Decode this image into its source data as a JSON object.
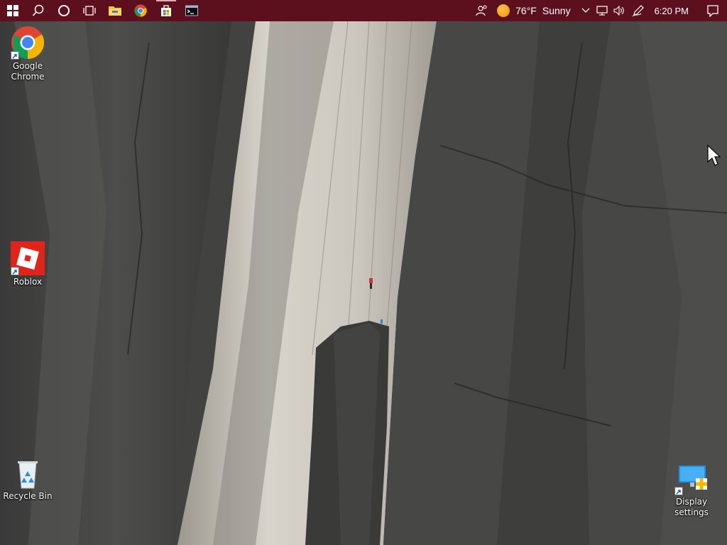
{
  "taskbar": {
    "color": "#5c0f1c",
    "pinned": [
      {
        "name": "start-button",
        "icon": "windows-logo-icon"
      },
      {
        "name": "search-button",
        "icon": "search-icon"
      },
      {
        "name": "cortana-button",
        "icon": "cortana-circle-icon"
      },
      {
        "name": "task-view-button",
        "icon": "task-view-icon"
      },
      {
        "name": "file-explorer-button",
        "icon": "folder-icon"
      },
      {
        "name": "chrome-button",
        "icon": "chrome-icon"
      },
      {
        "name": "microsoft-store-button",
        "icon": "store-icon",
        "active": true
      },
      {
        "name": "terminal-button",
        "icon": "terminal-icon"
      }
    ],
    "tray": {
      "people_icon": "people-icon",
      "weather": {
        "temperature": "76°F",
        "condition": "Sunny",
        "icon": "sun-icon"
      },
      "chevron_icon": "chevron-up-icon",
      "network_icon": "network-icon",
      "volume_icon": "volume-icon",
      "pen_icon": "pen-workspace-icon",
      "clock": "6:20 PM",
      "notifications_icon": "action-center-icon"
    }
  },
  "desktop": {
    "icons": [
      {
        "id": "chrome",
        "label": "Google\nChrome",
        "icon": "chrome-icon",
        "shortcut": true
      },
      {
        "id": "roblox",
        "label": "Roblox",
        "icon": "roblox-icon",
        "shortcut": true
      },
      {
        "id": "recycle-bin",
        "label": "Recycle Bin",
        "icon": "recycle-bin-icon",
        "shortcut": false
      },
      {
        "id": "display-settings",
        "label": "Display\nsettings",
        "icon": "display-settings-icon",
        "shortcut": true
      }
    ]
  }
}
